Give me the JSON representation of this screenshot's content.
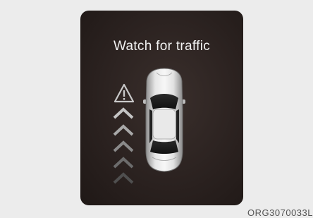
{
  "message": {
    "title": "Watch for traffic"
  },
  "image_code": "ORG3070033L",
  "icons": [
    "warning-triangle-icon",
    "approach-chevron-icon",
    "car-top-view-icon"
  ],
  "colors": {
    "panel": "#2b2220",
    "text": "#f2f2f2",
    "chevron_bright": "#bdbdbd"
  }
}
